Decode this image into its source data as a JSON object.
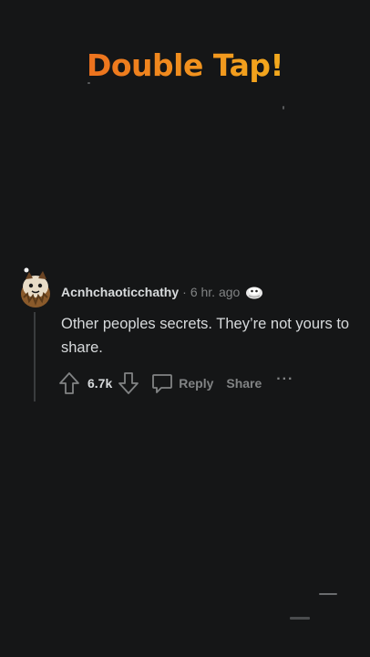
{
  "overlay": {
    "title": "Double Tap!"
  },
  "comment": {
    "username": "Acnhchaoticchathy",
    "separator": "·",
    "time": "6 hr. ago",
    "text": "Other peoples secrets. They’re not yours to share.",
    "upvotes": "6.7k",
    "reply_label": "Reply",
    "share_label": "Share",
    "more_label": "···",
    "avatar_icon": "snoo-avatar-icon",
    "award_icon": "award-icon"
  },
  "colors": {
    "background": "#151617",
    "text_primary": "#d7dadc",
    "text_secondary": "#818384",
    "title_gradient_start": "#e9571f",
    "title_gradient_end": "#f6c21c"
  }
}
